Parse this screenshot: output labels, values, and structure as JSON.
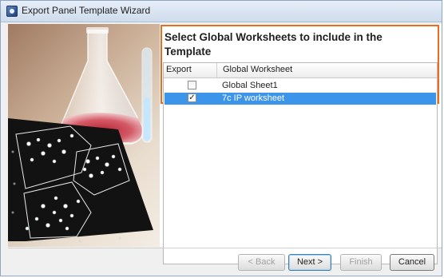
{
  "window": {
    "title": "Export Panel Template Wizard"
  },
  "colors": {
    "highlight_border": "#ee6b1d",
    "selection": "#3d95ea"
  },
  "content": {
    "heading": "Select Global Worksheets to include in the Template",
    "table": {
      "columns": [
        "Export",
        "Global Worksheet"
      ],
      "rows": [
        {
          "export": false,
          "name": "Global Sheet1",
          "selected": false
        },
        {
          "export": true,
          "name": "7c IP worksheet",
          "selected": true
        }
      ]
    }
  },
  "buttons": {
    "back": "< Back",
    "next": "Next >",
    "finish": "Finish",
    "cancel": "Cancel"
  },
  "icons": {
    "app": "wizard-app-icon",
    "checked_glyph": "✓"
  }
}
